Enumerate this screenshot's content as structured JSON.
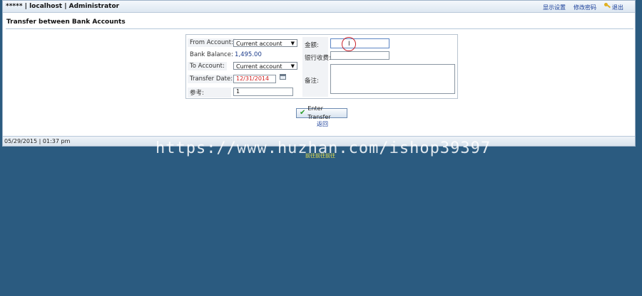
{
  "header": {
    "brand": "***** | localhost | Administrator",
    "links": [
      "显示设置",
      "修改密码",
      "退出"
    ]
  },
  "page": {
    "title": "Transfer between Bank Accounts"
  },
  "form": {
    "from_account_label": "From Account:",
    "from_account_value": "Current account",
    "bank_balance_label": "Bank Balance:",
    "bank_balance_value": "1,495.00",
    "to_account_label": "To Account:",
    "to_account_value": "Current account",
    "transfer_date_label": "Transfer Date:",
    "transfer_date_value": "12/31/2014",
    "reference_label": "参考:",
    "reference_value": "1",
    "amount_label": "金额:",
    "amount_value": "",
    "bank_charge_label": "银行收费:",
    "bank_charge_value": "",
    "memo_label": "备注:",
    "memo_value": ""
  },
  "actions": {
    "enter_transfer": "Enter Transfer",
    "back": "返回"
  },
  "status": {
    "datetime": "05/29/2015 | 01:37 pm"
  },
  "overlay": {
    "watermark": "https://www.huzhan.com/ishop39397",
    "footer_note": "前往前往前往"
  },
  "colors": {
    "background": "#2b5b80",
    "accent_link": "#1a3f9a",
    "date_text": "#d02020"
  }
}
